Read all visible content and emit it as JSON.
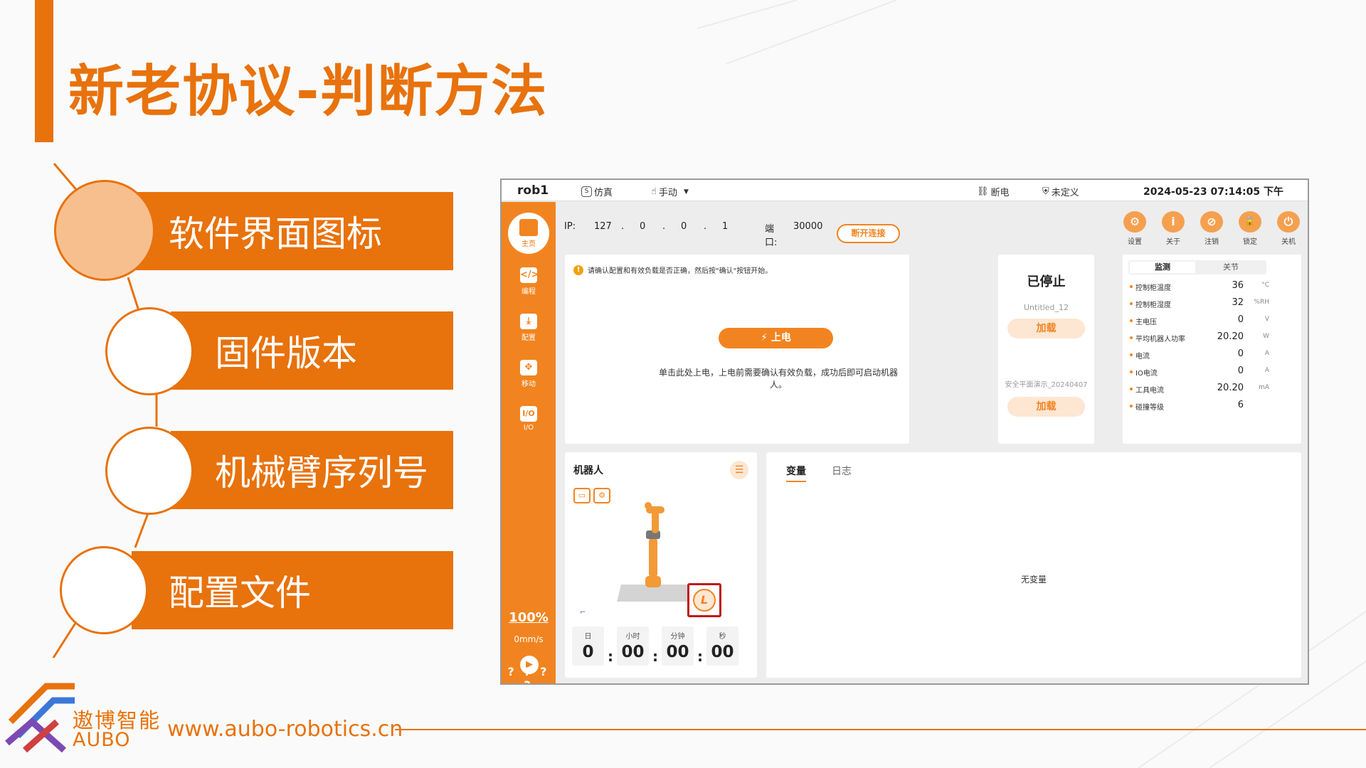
{
  "slide": {
    "title": "新老协议-判断方法",
    "menu": [
      {
        "label": "软件界面图标",
        "active": true
      },
      {
        "label": "固件版本",
        "active": false
      },
      {
        "label": "机械臂序列号",
        "active": false
      },
      {
        "label": "配置文件",
        "active": false
      }
    ],
    "footer": {
      "url": "www.aubo-robotics.cn",
      "logo_cn": "遨博智能",
      "logo_en": "AUBO"
    },
    "colors": {
      "accent": "#e8720c",
      "accent_light": "#f8bf8e",
      "highlight_box": "#c0171c"
    }
  },
  "app": {
    "topbar": {
      "robot_name": "rob1",
      "sim_label": "仿真",
      "mode_label": "手动",
      "power_state": "断电",
      "safety_label": "未定义",
      "datetime": "2024-05-23 07:14:05 下午"
    },
    "sidebar": {
      "home": "主页",
      "items": [
        {
          "icon": "code-icon",
          "label": "编程",
          "glyph": "</>"
        },
        {
          "icon": "config-icon",
          "label": "配置",
          "glyph": "⤓"
        },
        {
          "icon": "move-icon",
          "label": "移动",
          "glyph": "✥"
        },
        {
          "icon": "io-icon",
          "label": "I/O",
          "glyph": "I/O"
        }
      ],
      "speed_percent": "100%",
      "speed_value": "0mm/s",
      "bottom_status": "? ? ? ?"
    },
    "connection": {
      "ip_label": "IP:",
      "ip_parts": [
        "127",
        ".",
        "0",
        ".",
        "0",
        ".",
        "1"
      ],
      "port_label": "端口:",
      "port_value": "30000",
      "disconnect_label": "断开连接"
    },
    "toolbar": [
      {
        "icon": "settings-icon",
        "label": "设置",
        "glyph": "⚙"
      },
      {
        "icon": "info-icon",
        "label": "关于",
        "glyph": "i"
      },
      {
        "icon": "logout-icon",
        "label": "注销",
        "glyph": "⊘"
      },
      {
        "icon": "lock-icon",
        "label": "锁定",
        "glyph": "🔒"
      },
      {
        "icon": "power-icon",
        "label": "关机",
        "glyph": "⏻"
      }
    ],
    "power_panel": {
      "notice": "请确认配置和有效负载是否正确，然后按\"确认\"按钮开始。",
      "power_on_label": "上电",
      "description": "单击此处上电，上电前需要确认有效负载，成功后即可启动机器人。"
    },
    "program_panel": {
      "status": "已停止",
      "program_name": "Untitled_12",
      "load_label_1": "加载",
      "safety_config": "安全平面演示_20240407",
      "load_label_2": "加载"
    },
    "monitor": {
      "tab_monitor": "监测",
      "tab_joint": "关节",
      "rows": [
        {
          "label": "控制柜温度",
          "value": "36",
          "unit": "°C"
        },
        {
          "label": "控制柜湿度",
          "value": "32",
          "unit": "%RH"
        },
        {
          "label": "主电压",
          "value": "0",
          "unit": "V"
        },
        {
          "label": "平均机器人功率",
          "value": "20.20",
          "unit": "W"
        },
        {
          "label": "电流",
          "value": "0",
          "unit": "A"
        },
        {
          "label": "IO电流",
          "value": "0",
          "unit": "A"
        },
        {
          "label": "工具电流",
          "value": "20.20",
          "unit": "mA"
        },
        {
          "label": "碰撞等级",
          "value": "6",
          "unit": ""
        }
      ]
    },
    "robot_panel": {
      "title": "机器人",
      "l_button": "L",
      "timer": [
        {
          "label": "日",
          "value": "0"
        },
        {
          "label": "小时",
          "value": "00"
        },
        {
          "label": "分钟",
          "value": "00"
        },
        {
          "label": "秒",
          "value": "00"
        }
      ],
      "separator": ":"
    },
    "variables_panel": {
      "tab_variables": "变量",
      "tab_log": "日志",
      "empty_text": "无变量"
    }
  }
}
